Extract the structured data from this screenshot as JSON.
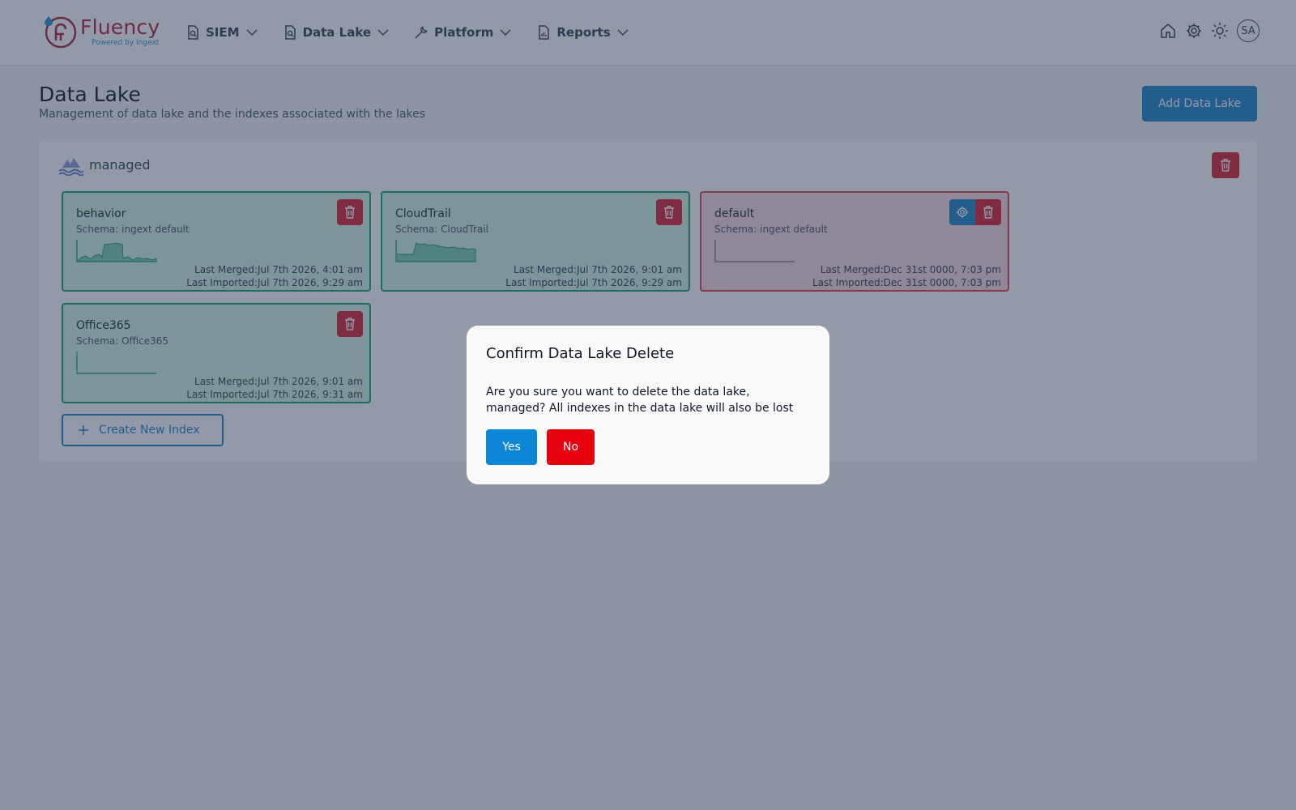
{
  "app": {
    "logo_text": "Fluency",
    "logo_sub": "Powered by Ingext"
  },
  "nav": {
    "items": [
      {
        "label": "SIEM",
        "icon": "search-doc-icon"
      },
      {
        "label": "Data Lake",
        "icon": "search-doc-icon"
      },
      {
        "label": "Platform",
        "icon": "wrench-icon"
      },
      {
        "label": "Reports",
        "icon": "report-icon"
      }
    ],
    "tools": [
      "home-icon",
      "gear-icon",
      "sun-icon"
    ],
    "avatar": "SA"
  },
  "page": {
    "title": "Data Lake",
    "subtitle": "Management of data lake and the indexes associated with the lakes",
    "add_button": "Add Data Lake"
  },
  "lake": {
    "name": "managed",
    "indexes": [
      {
        "name": "behavior",
        "schema": "Schema: ingext default",
        "last_merged": "Last Merged:Jul 7th 2026, 4:01 am",
        "last_imported": "Last Imported:Jul 7th 2026, 9:29 am",
        "status": "ok"
      },
      {
        "name": "CloudTrail",
        "schema": "Schema: CloudTrail",
        "last_merged": "Last Merged:Jul 7th 2026, 9:01 am",
        "last_imported": "Last Imported:Jul 7th 2026, 9:29 am",
        "status": "ok"
      },
      {
        "name": "default",
        "schema": "Schema: ingext default",
        "last_merged": "Last Merged:Dec 31st 0000, 7:03 pm",
        "last_imported": "Last Imported:Dec 31st 0000, 7:03 pm",
        "status": "error"
      },
      {
        "name": "Office365",
        "schema": "Schema: Office365",
        "last_merged": "Last Merged:Jul 7th 2026, 9:01 am",
        "last_imported": "Last Imported:Jul 7th 2026, 9:31 am",
        "status": "ok"
      }
    ],
    "create_index_label": "Create New Index"
  },
  "modal": {
    "title": "Confirm Data Lake Delete",
    "body": "Are you sure you want to delete the data lake, managed? All indexes in the data lake will also be lost",
    "yes_label": "Yes",
    "no_label": "No"
  },
  "colors": {
    "primary": "#0d86d6",
    "danger": "#e9000e",
    "ok_border": "#15a267",
    "error_border": "#e23a55",
    "brand": "#b01e3a"
  }
}
